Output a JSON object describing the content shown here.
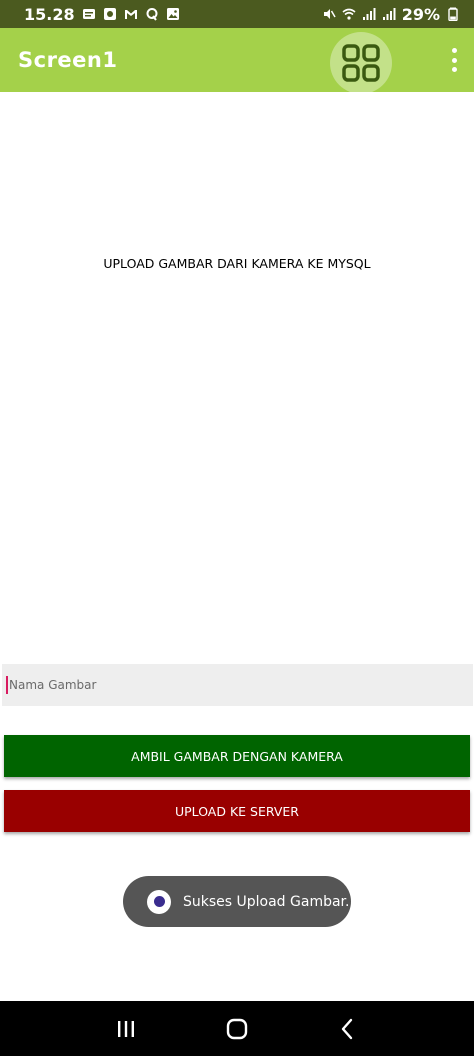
{
  "status_bar": {
    "time": "15.28",
    "battery": "29%",
    "left_icons": [
      "message-icon",
      "camera-icon",
      "gmail-icon",
      "quora-icon",
      "gallery-icon"
    ],
    "right_icons": [
      "mute-icon",
      "wifi-icon",
      "signal-icon",
      "signal-icon",
      "battery-icon"
    ]
  },
  "app_bar": {
    "title": "Screen1",
    "color": "#a4d14a"
  },
  "main": {
    "heading": "UPLOAD GAMBAR DARI KAMERA KE MYSQL",
    "name_field": {
      "placeholder": "Nama Gambar",
      "value": ""
    },
    "camera_button": {
      "label": "AMBIL GAMBAR DENGAN KAMERA",
      "color": "#006400"
    },
    "upload_button": {
      "label": "UPLOAD KE SERVER",
      "color": "#990000"
    }
  },
  "toast": {
    "text": "Sukses Upload Gambar."
  },
  "nav_bar": {
    "buttons": [
      "recents-icon",
      "home-icon",
      "back-icon"
    ]
  }
}
